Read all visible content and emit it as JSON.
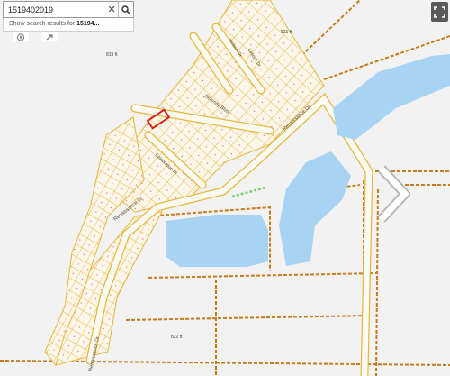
{
  "search": {
    "value": "1519402019",
    "clear_icon": "close-icon",
    "search_icon": "search-icon",
    "suggestion_prefix": "Show search results for ",
    "suggestion_query": "15194..."
  },
  "controls": {
    "compass_icon": "compass-icon",
    "locate_icon": "locate-icon",
    "expand_icon": "expand-icon",
    "next_icon": "chevron-right-icon"
  },
  "map": {
    "elevation_labels": [
      "821 ft",
      "819 ft",
      "822 ft"
    ],
    "street_labels": [
      "Kinloch Dr",
      "Kinloch Dr",
      "Serenity Blvd",
      "Renaissance Dr",
      "Celebration Dr",
      "Renaissance Dr",
      "Renaissance Dr"
    ],
    "colors": {
      "background": "#f2f2f2",
      "water": "#a9d3f2",
      "lot_line": "#e8b73c",
      "boundary": "#c87a1c",
      "selected_parcel": "#e0201a",
      "road": "#fbfbf5",
      "green_path": "#7ad26a"
    }
  }
}
